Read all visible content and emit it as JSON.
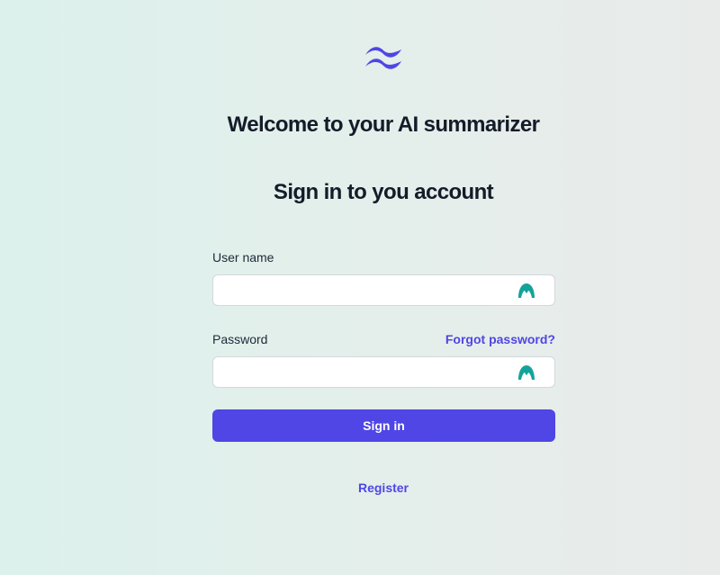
{
  "logo": {
    "icon": "wave-logo-icon",
    "color": "#4f46e5"
  },
  "header": {
    "title": "Welcome to your AI summarizer",
    "subtitle": "Sign in to you account"
  },
  "form": {
    "username": {
      "label": "User name",
      "value": "",
      "placeholder": ""
    },
    "password": {
      "label": "Password",
      "value": "",
      "placeholder": ""
    },
    "forgot_label": "Forgot password?",
    "submit_label": "Sign in",
    "field_icon": "password-manager-icon",
    "field_icon_color": "#14a39a"
  },
  "footer": {
    "register_label": "Register"
  },
  "colors": {
    "accent": "#4f46e5",
    "heading": "#141b29"
  }
}
